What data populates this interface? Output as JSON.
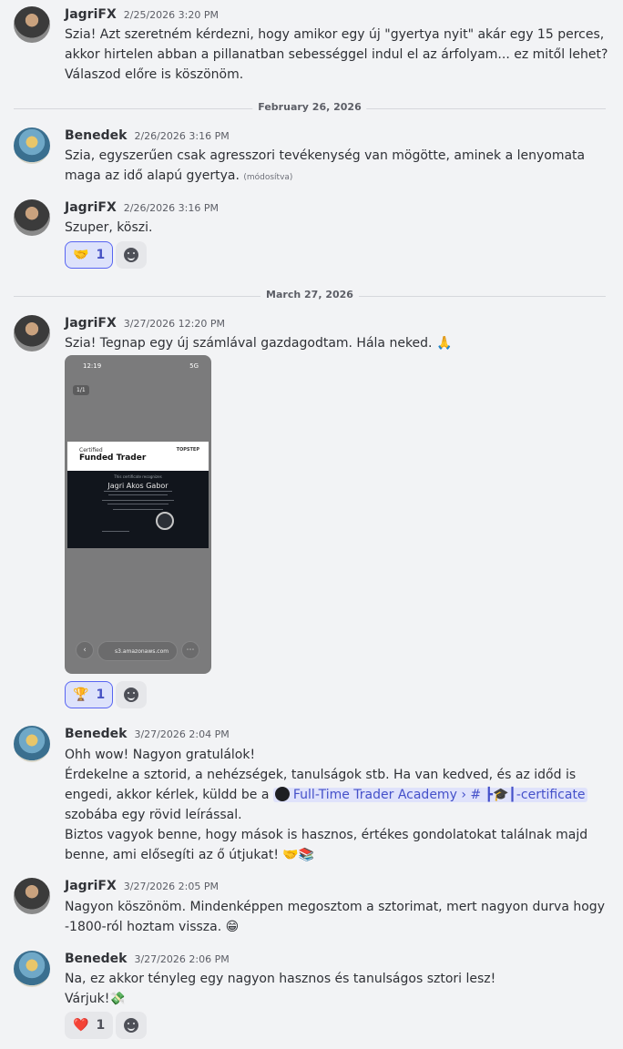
{
  "messages": [
    {
      "author": "JagriFX",
      "timestamp": "2/25/2026 3:20 PM",
      "lines": [
        "Szia! Azt szeretném kérdezni, hogy amikor egy új \"gyertya nyit\" akár egy 15 perces,",
        "akkor hirtelen abban a pillanatban sebességgel indul el az árfolyam... ez mitől lehet?",
        "Válaszod előre is köszönöm."
      ]
    },
    {
      "author": "Benedek",
      "timestamp": "2/26/2026 3:16 PM",
      "lines": [
        "Szia, egyszerűen csak agresszori tevékenység van mögötte, aminek a lenyomata",
        "maga az idő alapú gyertya."
      ],
      "edited": "(módosítva)"
    },
    {
      "author": "JagriFX",
      "timestamp": "2/26/2026 3:16 PM",
      "lines": [
        "Szuper, köszi."
      ],
      "reaction": {
        "icon": "handshake-emoji",
        "glyph": "🤝",
        "count": "1"
      }
    },
    {
      "author": "JagriFX",
      "timestamp": "3/27/2026 12:20 PM",
      "lines": [
        "Szia! Tegnap egy új számlával gazdagodtam. Hála neked. 🙏"
      ],
      "reaction": {
        "icon": "trophy-emoji",
        "glyph": "🏆",
        "count": "1"
      }
    },
    {
      "author": "Benedek",
      "timestamp": "3/27/2026 2:04 PM",
      "lines": [
        "Ohh wow! Nagyon gratulálok!",
        "Érdekelne a sztorid, a nehézségek, tanulságok stb. Ha van kedved, és az időd is",
        "engedi, akkor kérlek, küldd be a",
        "szobába egy rövid leírással.",
        "Biztos vagyok benne, hogy mások is hasznos, értékes gondolatokat találnak majd",
        "benne, ami elősegíti az ő útjukat! 🤝📚"
      ],
      "channel_mention": {
        "server": "Full-Time Trader Academy",
        "separator": "›",
        "hash": "#",
        "channel": "┣🎓┃-certificate"
      }
    },
    {
      "author": "JagriFX",
      "timestamp": "3/27/2026 2:05 PM",
      "lines": [
        "Nagyon köszönöm. Mindenképpen megosztom a sztorimat, mert nagyon durva hogy",
        "-1800-ról hoztam vissza. 😁"
      ]
    },
    {
      "author": "Benedek",
      "timestamp": "3/27/2026 2:06 PM",
      "lines": [
        "Na, ez akkor tényleg egy nagyon hasznos és tanulságos sztori lesz!",
        "Várjuk!💸"
      ],
      "reaction": {
        "icon": "heart-emoji",
        "glyph": "❤️",
        "count": "1"
      }
    }
  ],
  "dividers": [
    "February 26, 2026",
    "March 27, 2026"
  ],
  "attachment": {
    "phone_time": "12:19",
    "phone_signal": "5G",
    "page_indicator": "1/1",
    "certificate": {
      "caption": "Certified",
      "title": "Funded Trader",
      "brand": "TOPSTEP",
      "presented": "This certificate recognizes",
      "name": "Jagri Akos Gabor"
    },
    "url": "s3.amazonaws.com"
  },
  "colors": {
    "background": "#f2f3f5",
    "mention": "#4450c9",
    "reaction_active": "#5865f2"
  }
}
